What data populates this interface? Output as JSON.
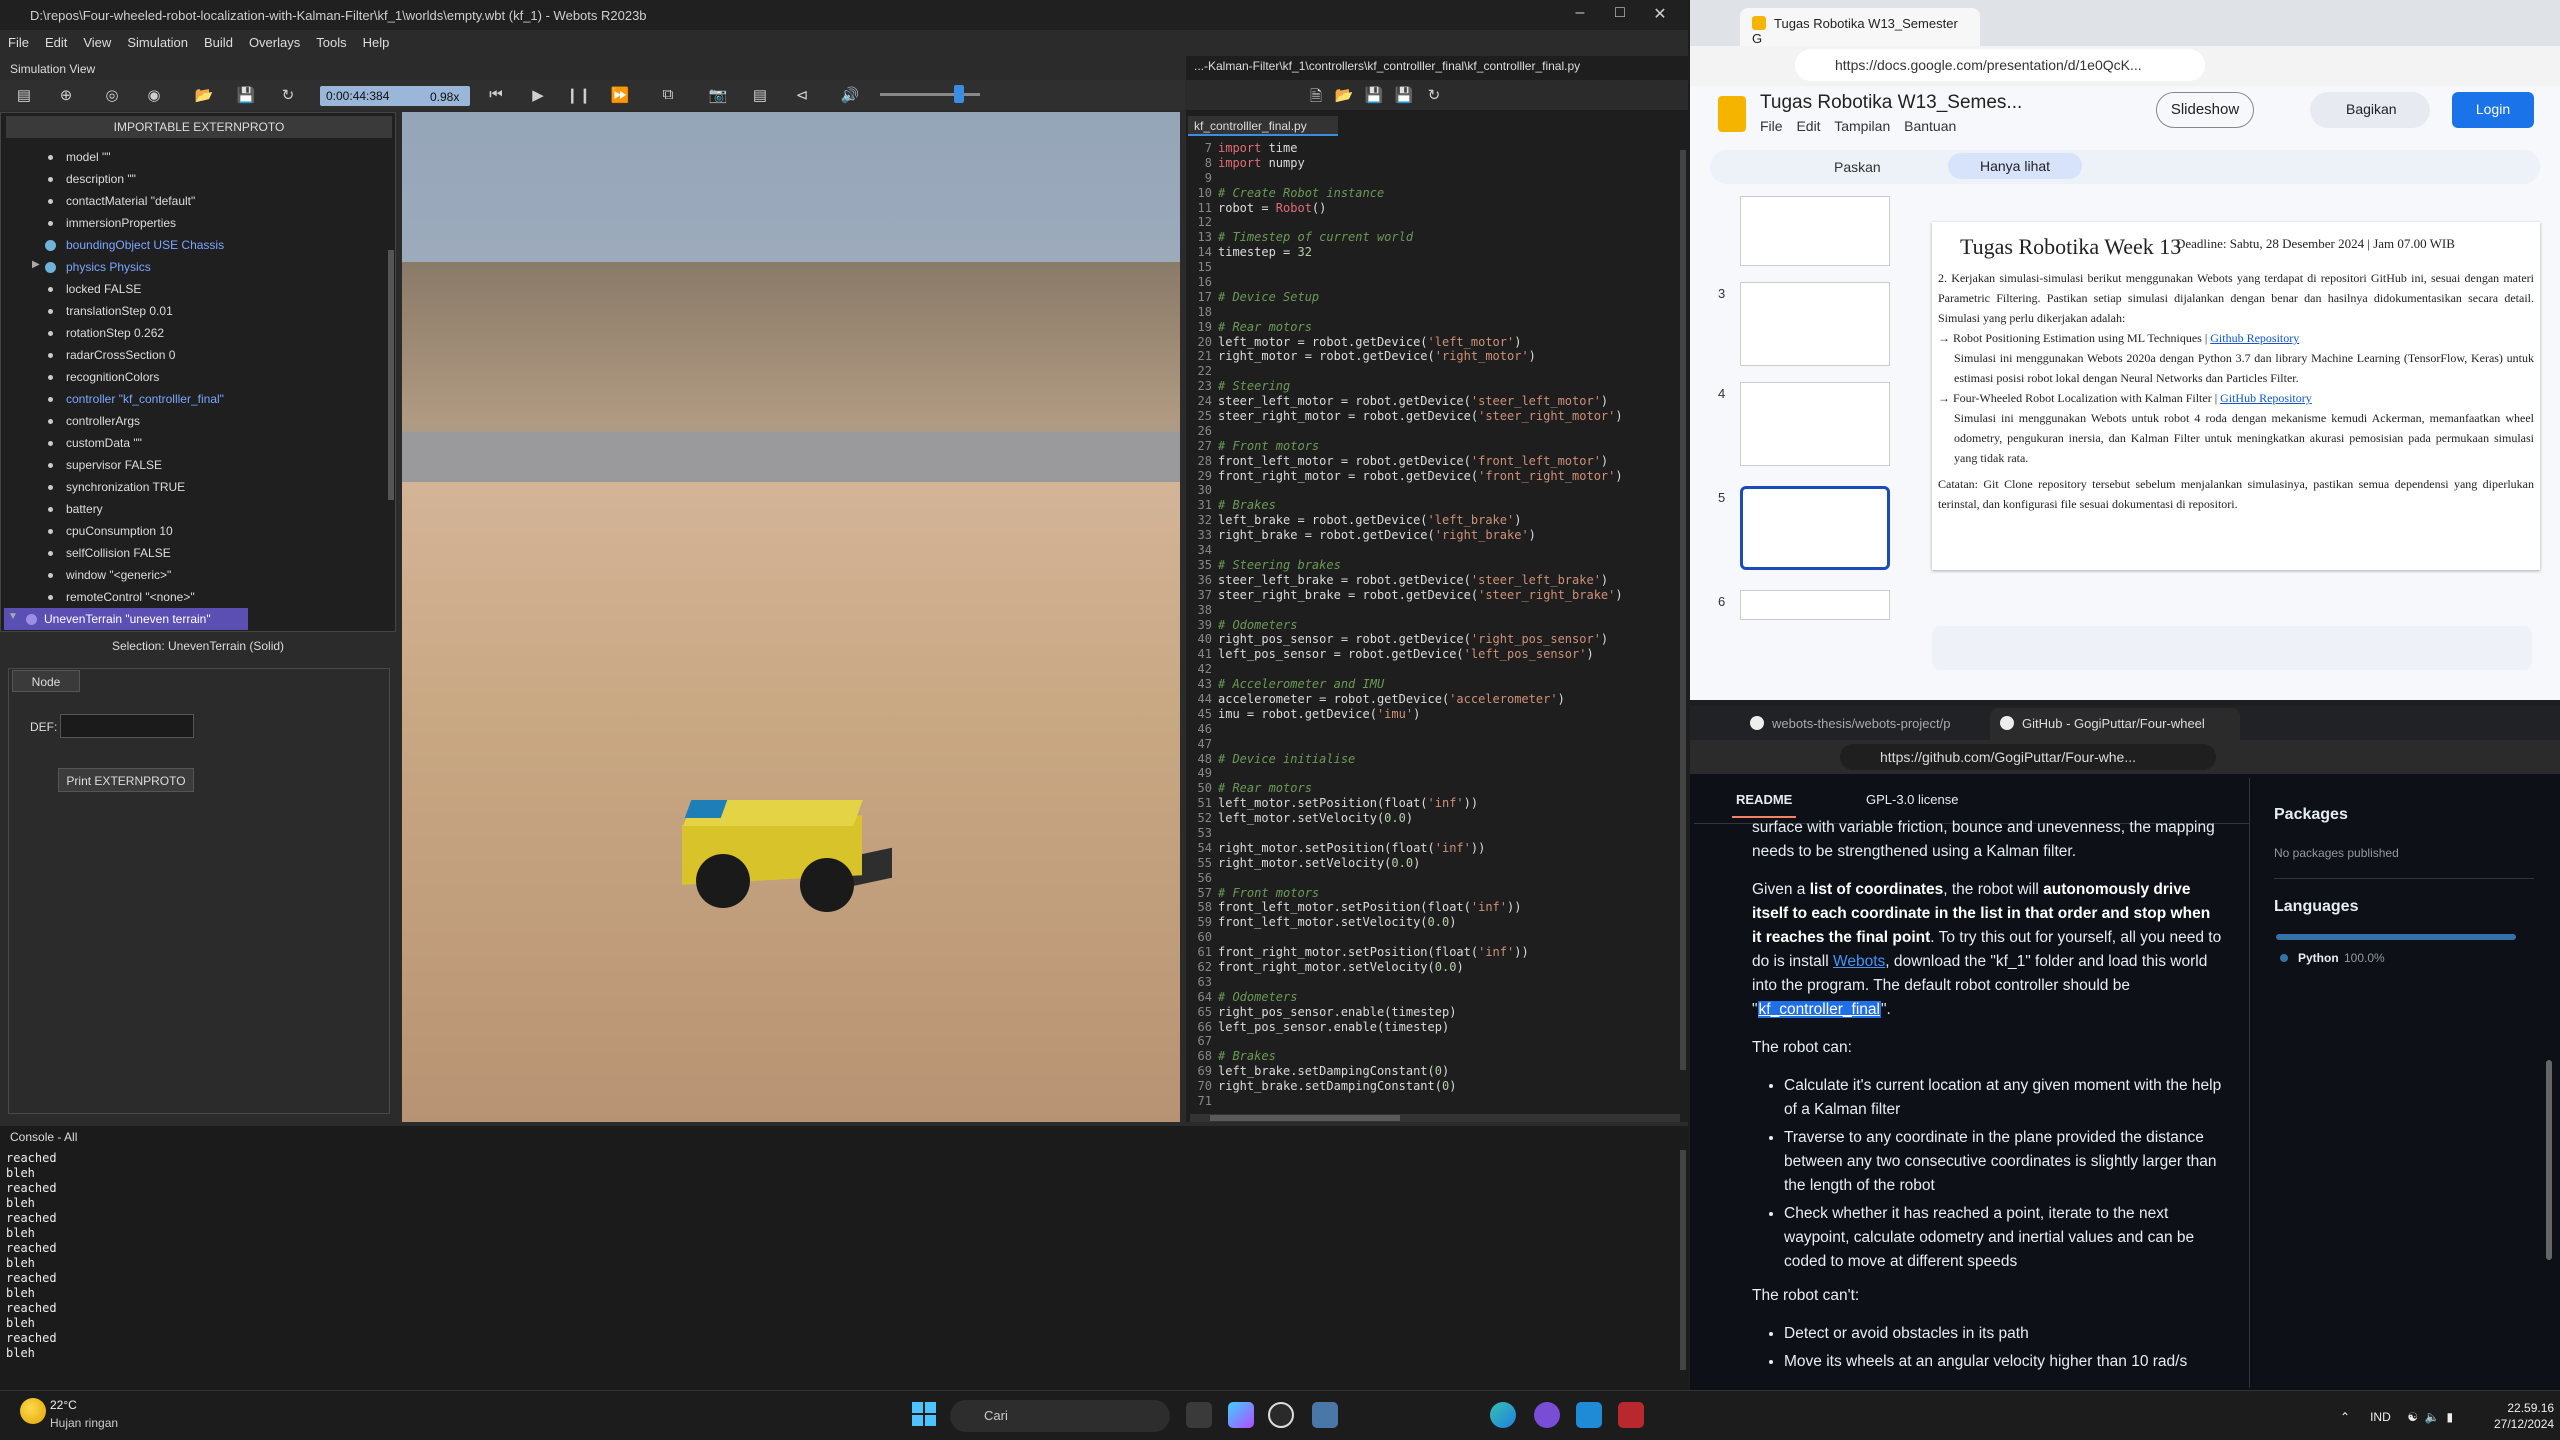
{
  "webots": {
    "title": "D:\\repos\\Four-wheeled-robot-localization-with-Kalman-Filter\\kf_1\\worlds\\empty.wbt (kf_1) - Webots R2023b",
    "menu": [
      "File",
      "Edit",
      "View",
      "Simulation",
      "Build",
      "Overlays",
      "Tools",
      "Help"
    ],
    "sim_view_label": "Simulation View",
    "time": "0:00:44:384",
    "speed": "0.98x",
    "tree_header": "IMPORTABLE EXTERNPROTO",
    "tree_items": [
      "model \"\"",
      "description \"\"",
      "contactMaterial \"default\"",
      "immersionProperties",
      "boundingObject USE Chassis",
      "physics Physics",
      "locked FALSE",
      "translationStep 0.01",
      "rotationStep 0.262",
      "radarCrossSection 0",
      "recognitionColors",
      "controller \"kf_controlller_final\"",
      "controllerArgs",
      "customData \"\"",
      "supervisor FALSE",
      "synchronization TRUE",
      "battery",
      "cpuConsumption 10",
      "selfCollision FALSE",
      "window \"<generic>\"",
      "remoteControl \"<none>\"",
      "UnevenTerrain \"uneven terrain\""
    ],
    "selection": "Selection: UnevenTerrain (Solid)",
    "node_tab": "Node",
    "def_label": "DEF:",
    "print_button": "Print EXTERNPROTO",
    "editor_title": "...-Kalman-Filter\\kf_1\\controllers\\kf_controlller_final\\kf_controlller_final.py",
    "editor_tab": "kf_controlller_final.py",
    "console_title": "Console - All",
    "console_lines": [
      "reached",
      "bleh",
      "reached",
      "bleh",
      "reached",
      "bleh",
      "reached",
      "bleh",
      "reached",
      "bleh",
      "reached",
      "bleh",
      "reached",
      "bleh"
    ]
  },
  "code_lines": [
    {
      "n": "7",
      "html": "<span class='kw'>import</span> time"
    },
    {
      "n": "8",
      "html": "<span class='kw'>import</span> numpy"
    },
    {
      "n": "9",
      "html": ""
    },
    {
      "n": "10",
      "html": "<span class='cm'># Create Robot instance</span>"
    },
    {
      "n": "11",
      "html": "robot = <span class='kw'>Robot</span>()"
    },
    {
      "n": "12",
      "html": ""
    },
    {
      "n": "13",
      "html": "<span class='cm'># Timestep of current world</span>"
    },
    {
      "n": "14",
      "html": "timestep = <span class='nm'>32</span>"
    },
    {
      "n": "15",
      "html": ""
    },
    {
      "n": "16",
      "html": ""
    },
    {
      "n": "17",
      "html": "<span class='cm'># Device Setup</span>"
    },
    {
      "n": "18",
      "html": ""
    },
    {
      "n": "19",
      "html": "<span class='cm'># Rear motors</span>"
    },
    {
      "n": "20",
      "html": "left_motor = robot.getDevice(<span class='st'>'left_motor'</span>)"
    },
    {
      "n": "21",
      "html": "right_motor = robot.getDevice(<span class='st'>'right_motor'</span>)"
    },
    {
      "n": "22",
      "html": ""
    },
    {
      "n": "23",
      "html": "<span class='cm'># Steering</span>"
    },
    {
      "n": "24",
      "html": "steer_left_motor = robot.getDevice(<span class='st'>'steer_left_motor'</span>)"
    },
    {
      "n": "25",
      "html": "steer_right_motor = robot.getDevice(<span class='st'>'steer_right_motor'</span>)"
    },
    {
      "n": "26",
      "html": ""
    },
    {
      "n": "27",
      "html": "<span class='cm'># Front motors</span>"
    },
    {
      "n": "28",
      "html": "front_left_motor = robot.getDevice(<span class='st'>'front_left_motor'</span>)"
    },
    {
      "n": "29",
      "html": "front_right_motor = robot.getDevice(<span class='st'>'front_right_motor'</span>)"
    },
    {
      "n": "30",
      "html": ""
    },
    {
      "n": "31",
      "html": "<span class='cm'># Brakes</span>"
    },
    {
      "n": "32",
      "html": "left_brake = robot.getDevice(<span class='st'>'left_brake'</span>)"
    },
    {
      "n": "33",
      "html": "right_brake = robot.getDevice(<span class='st'>'right_brake'</span>)"
    },
    {
      "n": "34",
      "html": ""
    },
    {
      "n": "35",
      "html": "<span class='cm'># Steering brakes</span>"
    },
    {
      "n": "36",
      "html": "steer_left_brake = robot.getDevice(<span class='st'>'steer_left_brake'</span>)"
    },
    {
      "n": "37",
      "html": "steer_right_brake = robot.getDevice(<span class='st'>'steer_right_brake'</span>)"
    },
    {
      "n": "38",
      "html": ""
    },
    {
      "n": "39",
      "html": "<span class='cm'># Odometers</span>"
    },
    {
      "n": "40",
      "html": "right_pos_sensor = robot.getDevice(<span class='st'>'right_pos_sensor'</span>)"
    },
    {
      "n": "41",
      "html": "left_pos_sensor = robot.getDevice(<span class='st'>'left_pos_sensor'</span>)"
    },
    {
      "n": "42",
      "html": ""
    },
    {
      "n": "43",
      "html": "<span class='cm'># Accelerometer and IMU</span>"
    },
    {
      "n": "44",
      "html": "accelerometer = robot.getDevice(<span class='st'>'accelerometer'</span>)"
    },
    {
      "n": "45",
      "html": "imu = robot.getDevice(<span class='st'>'imu'</span>)"
    },
    {
      "n": "46",
      "html": ""
    },
    {
      "n": "47",
      "html": ""
    },
    {
      "n": "48",
      "html": "<span class='cm'># Device initialise</span>"
    },
    {
      "n": "49",
      "html": ""
    },
    {
      "n": "50",
      "html": "<span class='cm'># Rear motors</span>"
    },
    {
      "n": "51",
      "html": "left_motor.setPosition(float(<span class='st'>'inf'</span>))"
    },
    {
      "n": "52",
      "html": "left_motor.setVelocity(<span class='nm'>0.0</span>)"
    },
    {
      "n": "53",
      "html": ""
    },
    {
      "n": "54",
      "html": "right_motor.setPosition(float(<span class='st'>'inf'</span>))"
    },
    {
      "n": "55",
      "html": "right_motor.setVelocity(<span class='nm'>0.0</span>)"
    },
    {
      "n": "56",
      "html": ""
    },
    {
      "n": "57",
      "html": "<span class='cm'># Front motors</span>"
    },
    {
      "n": "58",
      "html": "front_left_motor.setPosition(float(<span class='st'>'inf'</span>))"
    },
    {
      "n": "59",
      "html": "front_left_motor.setVelocity(<span class='nm'>0.0</span>)"
    },
    {
      "n": "60",
      "html": ""
    },
    {
      "n": "61",
      "html": "front_right_motor.setPosition(float(<span class='st'>'inf'</span>))"
    },
    {
      "n": "62",
      "html": "front_right_motor.setVelocity(<span class='nm'>0.0</span>)"
    },
    {
      "n": "63",
      "html": ""
    },
    {
      "n": "64",
      "html": "<span class='cm'># Odometers</span>"
    },
    {
      "n": "65",
      "html": "right_pos_sensor.enable(timestep)"
    },
    {
      "n": "66",
      "html": "left_pos_sensor.enable(timestep)"
    },
    {
      "n": "67",
      "html": ""
    },
    {
      "n": "68",
      "html": "<span class='cm'># Brakes</span>"
    },
    {
      "n": "69",
      "html": "left_brake.setDampingConstant(<span class='nm'>0</span>)"
    },
    {
      "n": "70",
      "html": "right_brake.setDampingConstant(<span class='nm'>0</span>)"
    },
    {
      "n": "71",
      "html": ""
    }
  ],
  "edge1": {
    "tab_title": "Tugas Robotika W13_Semester G",
    "url": "https://docs.google.com/presentation/d/1e0QcK...",
    "doc_title": "Tugas Robotika W13_Semes...",
    "menu": "File  Edit  Tampilan  Bantuan",
    "slideshow": "Slideshow",
    "share": "Bagikan",
    "login": "Login",
    "zoom": "Paskan",
    "view_only": "Hanya lihat",
    "thumb_nums": [
      "3",
      "4",
      "5",
      "6"
    ],
    "slide_title": "Tugas Robotika Week 13",
    "deadline": "Deadline: Sabtu, 28 Desember 2024  | Jam 07.00 WIB",
    "para1": "2. Kerjakan simulasi-simulasi berikut menggunakan Webots yang terdapat di repositori GitHub ini, sesuai dengan materi Parametric Filtering. Pastikan setiap simulasi dijalankan dengan benar dan hasilnya didokumentasikan secara detail. Simulasi yang perlu dikerjakan adalah:",
    "item1_title": "→ Robot Positioning Estimation using ML Techniques | ",
    "item1_link": "Github Repository",
    "item1_desc": "Simulasi ini menggunakan Webots 2020a dengan Python 3.7 dan library Machine Learning (TensorFlow, Keras) untuk estimasi posisi robot lokal dengan Neural Networks dan Particles Filter.",
    "item2_title": "→ Four-Wheeled Robot Localization with Kalman Filter | ",
    "item2_link": "GitHub Repository",
    "item2_desc": "Simulasi ini menggunakan Webots untuk robot 4 roda dengan mekanisme kemudi Ackerman, memanfaatkan wheel odometry, pengukuran inersia, dan Kalman Filter untuk meningkatkan akurasi pemosisian pada permukaan simulasi yang tidak rata.",
    "note": "Catatan: Git Clone repository tersebut sebelum menjalankan simulasinya, pastikan semua dependensi yang diperlukan terinstal, dan konfigurasi file sesuai dokumentasi di repositori."
  },
  "edge2": {
    "tab1": "webots-thesis/webots-project/p",
    "tab2": "GitHub - GogiPuttar/Four-wheel",
    "url": "https://github.com/GogiPuttar/Four-whe...",
    "readme": "README",
    "license": "GPL-3.0 license",
    "p0": "surface with variable friction, bounce and unevenness, the mapping needs to be strengthened using a Kalman filter.",
    "p1a": "Given a ",
    "p1b": "list of coordinates",
    "p1c": ", the robot will ",
    "p1d": "autonomously drive itself to each coordinate in the list in that order and stop when it reaches the final point",
    "p1e": ". To try this out for yourself, all you need to do is install ",
    "p1link": "Webots",
    "p1f": ", download the \"kf_1\" folder and load this world into the program. The default robot controller should be \"",
    "p1hl": "kf_controller_final",
    "p1g": "\".",
    "can_h": "The robot can:",
    "can": [
      "Calculate it's current location at any given moment with the help of a Kalman filter",
      "Traverse to any coordinate in the plane provided the distance between any two consecutive coordinates is slightly larger than the length of the robot",
      "Check whether it has reached a point, iterate to the next waypoint, calculate odometry and inertial values and can be coded to move at different speeds"
    ],
    "cant_h": "The robot can't:",
    "cant": [
      "Detect or avoid obstacles in its path",
      "Move its wheels at an angular velocity higher than 10 rad/s"
    ],
    "packages_h": "Packages",
    "packages_t": "No packages published",
    "languages_h": "Languages",
    "lang_name": "Python",
    "lang_pct": "100.0%"
  },
  "taskbar": {
    "temp": "22°C",
    "weather": "Hujan ringan",
    "search": "Cari",
    "lang": "IND",
    "time": "22.59.16",
    "date": "27/12/2024"
  }
}
